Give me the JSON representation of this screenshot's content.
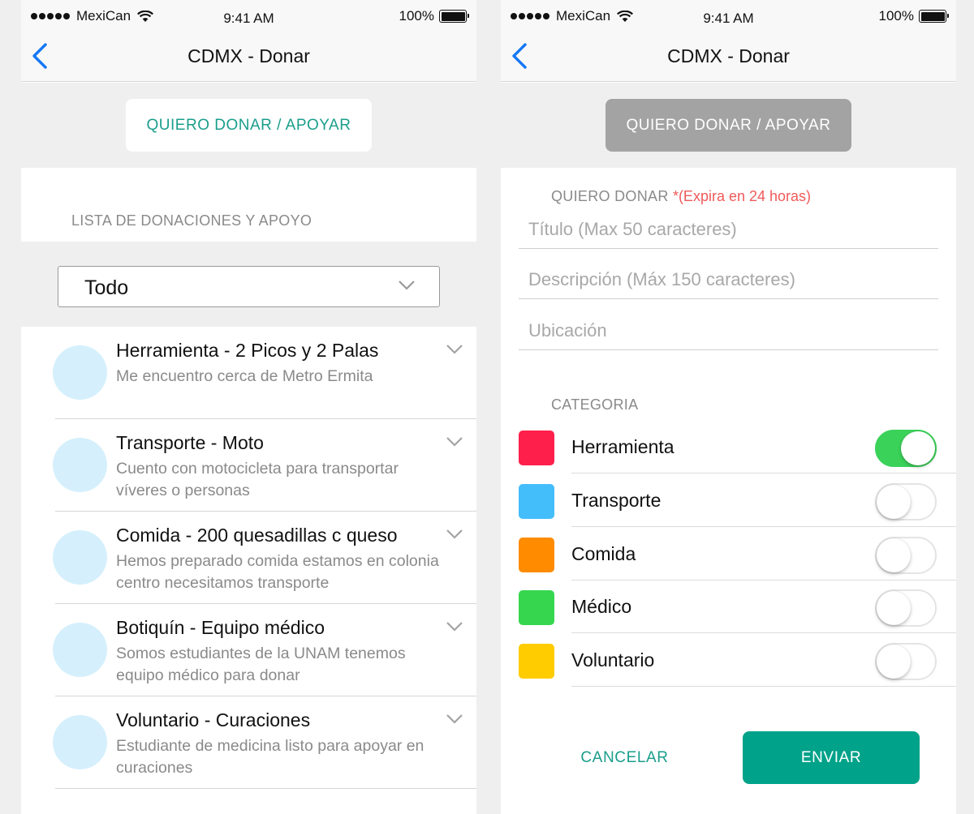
{
  "status_bar": {
    "carrier": "MexiCan",
    "time": "9:41 AM",
    "battery": "100%"
  },
  "left": {
    "nav_title": "CDMX - Donar",
    "main_button": "QUIERO DONAR / APOYAR",
    "list_label": "LISTA DE DONACIONES Y APOYO",
    "filter": {
      "selected": "Todo"
    },
    "items": [
      {
        "title": "Herramienta - 2 Picos y 2 Palas",
        "desc": "Me encuentro cerca de Metro Ermita"
      },
      {
        "title": "Transporte - Moto",
        "desc": "Cuento con motocicleta para transportar víveres o personas"
      },
      {
        "title": "Comida - 200 quesadillas c queso",
        "desc": "Hemos preparado comida estamos en colonia centro necesitamos transporte"
      },
      {
        "title": "Botiquín - Equipo médico",
        "desc": "Somos estudiantes de la UNAM tenemos equipo médico para donar"
      },
      {
        "title": "Voluntario - Curaciones",
        "desc": "Estudiante de medicina listo para apoyar en curaciones"
      }
    ]
  },
  "right": {
    "nav_title": "CDMX - Donar",
    "main_button": "QUIERO DONAR / APOYAR",
    "form_label": "QUIERO DONAR",
    "form_label_note": "*(Expira en 24 horas)",
    "fields": {
      "title_placeholder": "Título (Max 50 caracteres)",
      "desc_placeholder": "Descripción (Máx 150 caracteres)",
      "location_placeholder": "Ubicación"
    },
    "category_label": "CATEGORIA",
    "categories": [
      {
        "label": "Herramienta",
        "color": "#ff1f4b",
        "enabled": true
      },
      {
        "label": "Transporte",
        "color": "#44bdfb",
        "enabled": false
      },
      {
        "label": "Comida",
        "color": "#ff8b00",
        "enabled": false
      },
      {
        "label": "Médico",
        "color": "#36d64f",
        "enabled": false
      },
      {
        "label": "Voluntario",
        "color": "#ffcc00",
        "enabled": false
      }
    ],
    "cancel_label": "CANCELAR",
    "send_label": "ENVIAR"
  }
}
